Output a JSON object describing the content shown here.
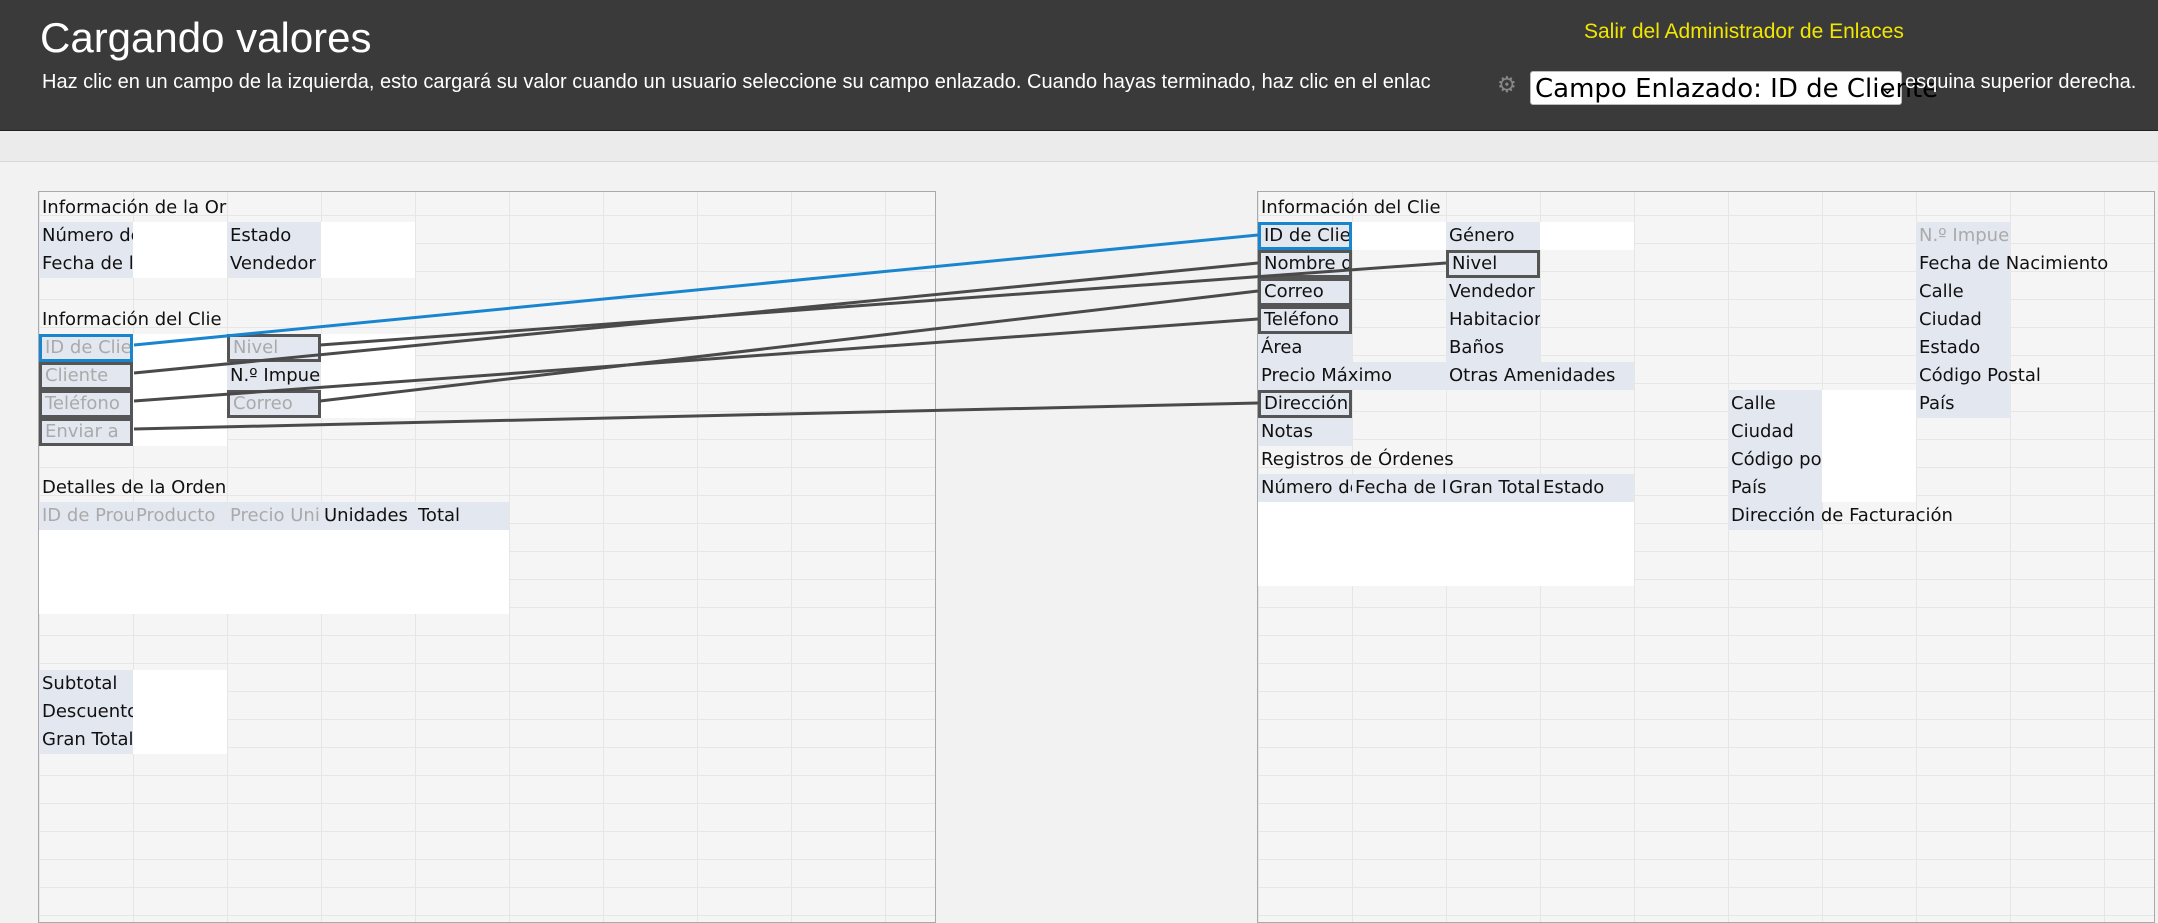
{
  "header": {
    "title": "Cargando valores",
    "instructions": "Haz clic en un campo de la izquierda, esto cargará su valor cuando un usuario seleccione su campo enlazado. Cuando hayas terminado, haz clic en el enlace en la esquina superior derecha.",
    "instructions_pre": "Haz clic en un campo de la izquierda, esto cargará su valor cuando un usuario seleccione su campo enlazado. Cuando hayas terminado, haz clic en el enlac",
    "instructions_post": "esquina superior derecha.",
    "exit_link": "Salir del Administrador de Enlaces",
    "linked_field_select": "Campo Enlazado: ID de Cliente"
  },
  "left_panel": {
    "order_info": "Información de la Or",
    "order_number": "Número de Orden",
    "status": "Estado",
    "order_date": "Fecha de la Orden",
    "seller": "Vendedor",
    "client_info": "Información del Clie",
    "client_id": "ID de Clie",
    "level": "Nivel",
    "client": "Cliente",
    "tax_number": "N.º Impuesto",
    "phone": "Teléfono",
    "email": "Correo",
    "ship_to": "Enviar a",
    "order_details": "Detalles de la Orden",
    "columns": [
      "ID de Prou",
      "Producto",
      "Precio Uni",
      "Unidades",
      "Total"
    ],
    "subtotal": "Subtotal",
    "discount": "Descuento",
    "grand_total": "Gran Total"
  },
  "right_panel": {
    "client_info": "Información del Clie",
    "client_id": "ID de Cliente",
    "gender": "Género",
    "tax_number": "N.º Impuesto",
    "client_name": "Nombre del Cliente",
    "level": "Nivel",
    "birth_date": "Fecha de Nacimiento",
    "email": "Correo",
    "seller": "Vendedor",
    "street": "Calle",
    "phone": "Teléfono",
    "rooms": "Habitaciones",
    "city": "Ciudad",
    "area": "Área",
    "bathrooms": "Baños",
    "state": "Estado",
    "max_price": "Precio Máximo",
    "other_amenities": "Otras Amenidades",
    "postal_code": "Código Postal",
    "postal_address": "Dirección Postal",
    "street2": "Calle",
    "country": "País",
    "notes": "Notas",
    "city2": "Ciudad",
    "order_records": "Registros de Órdenes",
    "postal_code2": "Código postal",
    "columns": [
      "Número de",
      "Fecha de l",
      "Gran Total",
      "Estado"
    ],
    "country2": "País",
    "billing_address": "Dirección de Facturación"
  },
  "colors": {
    "header_bg": "#3a3a3a",
    "exit_link": "#f2e600",
    "active_link": "#1a85cf",
    "link": "#555555"
  }
}
